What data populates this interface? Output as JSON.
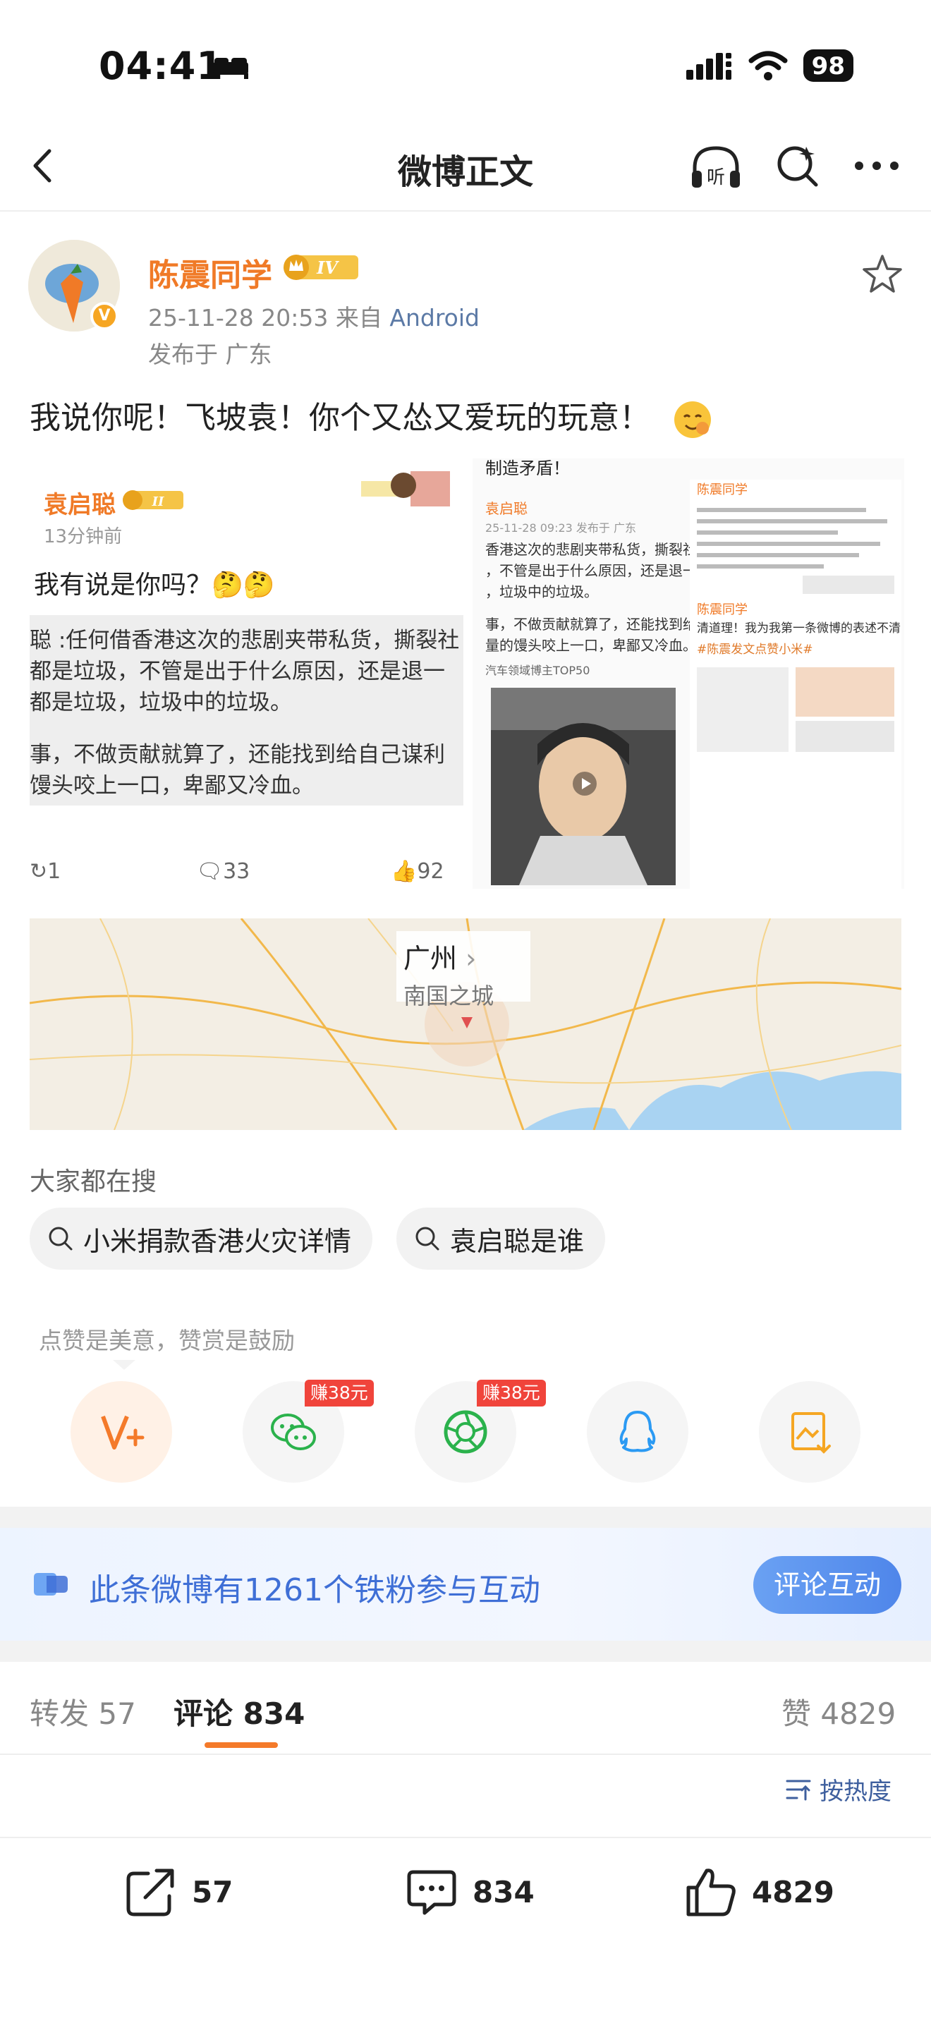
{
  "status": {
    "time": "04:41",
    "battery": "98"
  },
  "nav": {
    "title": "微博正文"
  },
  "author": {
    "name": "陈震同学",
    "level": "IV",
    "meta_time": "25-11-28 20:53",
    "meta_from": "来自",
    "meta_source": "Android",
    "location": "发布于 广东"
  },
  "post": {
    "text": "我说你呢！飞坡袁！你个又怂又爱玩的玩意！"
  },
  "image_left": {
    "name": "袁启聪",
    "level": "II",
    "time": "13分钟前",
    "reply": "我有说是你吗？🤔🤔",
    "quote_lines": [
      "聪 :任何借香港这次的悲剧夹带私货，撕裂社",
      "都是垃圾，不管是出于什么原因，还是退一",
      "都是垃圾，垃圾中的垃圾。",
      "事，不做贡献就算了，还能找到给自己谋利",
      "馒头咬上一口，卑鄙又冷血。"
    ],
    "repost": "1",
    "comments": "33",
    "likes": "92"
  },
  "image_right": {
    "top": "制造矛盾！",
    "name": "袁启聪",
    "time": "25-11-28 09:23  发布于 广东",
    "lines": [
      "香港这次的悲剧夹带私货，撕裂社",
      "，不管是出于什么原因，还是退一",
      "，垃圾中的垃圾。",
      "",
      "事，不做贡献就算了，还能找到给",
      "量的馒头咬上一口，卑鄙又冷血。",
      "",
      "汽车领域博主TOP50"
    ],
    "col2_name": "陈震同学",
    "col2_name2": "陈震同学",
    "col2_line": "清道理！我为我第一条微博的表述不清 道歉",
    "col2_tag": "#陈震发文点赞小米#"
  },
  "map": {
    "city": "广州",
    "slogan": "南国之城"
  },
  "search": {
    "title": "大家都在搜",
    "chips": [
      "小米捐款香港火灾详情",
      "袁启聪是谁"
    ]
  },
  "reward": {
    "tip": "点赞是美意，赞赏是鼓励",
    "earn1": "赚38元",
    "earn2": "赚38元"
  },
  "fans": {
    "text": "此条微博有1261个铁粉参与互动",
    "button": "评论互动"
  },
  "tabs": {
    "repost": "转发 57",
    "comment": "评论 834",
    "like": "赞 4829"
  },
  "sort": {
    "label": "按热度"
  },
  "toolbar": {
    "repost": "57",
    "comment": "834",
    "like": "4829"
  },
  "colors": {
    "accent_orange": "#f07a27",
    "link_blue": "#3f6fd6",
    "badge_red": "#f0443b"
  }
}
